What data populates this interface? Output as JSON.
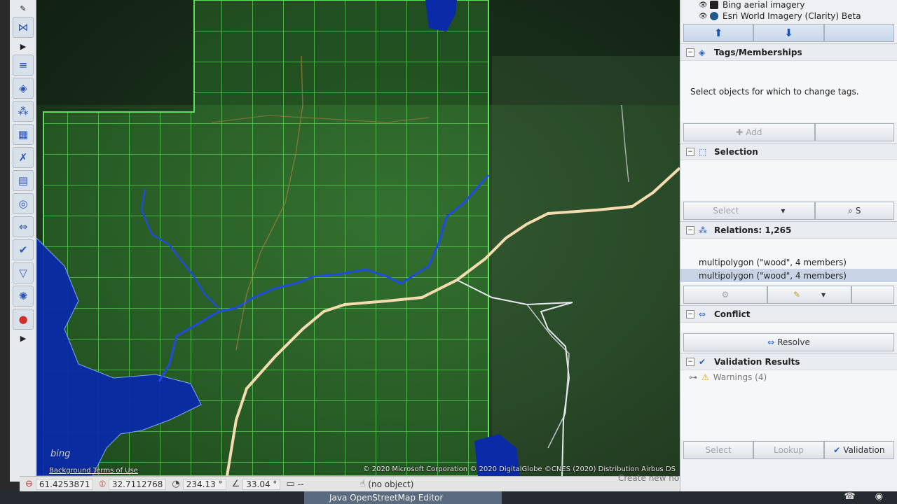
{
  "window_title": "Java OpenStreetMap Editor",
  "layers": [
    {
      "name": "Bing aerial imagery"
    },
    {
      "name": "Esri World Imagery (Clarity) Beta"
    }
  ],
  "tags_panel": {
    "title": "Tags/Memberships",
    "empty_message": "Select objects for which to change tags.",
    "add_label": "Add"
  },
  "selection_panel": {
    "title": "Selection",
    "select_label": "Select",
    "search_label": "S"
  },
  "relations_panel": {
    "title": "Relations: 1,265",
    "items": [
      {
        "label": "multipolygon (\"wood\", 4 members)"
      },
      {
        "label": "multipolygon (\"wood\", 4 members)"
      }
    ]
  },
  "conflict_panel": {
    "title": "Conflict",
    "resolve_label": "Resolve"
  },
  "validation_panel": {
    "title": "Validation Results",
    "warnings_label": "Warnings (4)",
    "select_label": "Select",
    "lookup_label": "Lookup",
    "validation_label": "Validation"
  },
  "status": {
    "lat": "61.4253871",
    "lon": "32.7112768",
    "heading": "234.13 °",
    "angle": "33.04 °",
    "distance": "--",
    "object": "(no object)",
    "help": "Create new node."
  },
  "map": {
    "attribution": "© 2020 Microsoft Corporation © 2020 DigitalGlobe ©CNES (2020) Distribution Airbus DS",
    "terms": "Background Terms of Use",
    "logo": "bing"
  },
  "colors": {
    "grid": "#5fe05a",
    "water": "#0a2aa8",
    "river": "#1f4be0",
    "road": "#f2dcb0",
    "path": "#e8e8f0"
  }
}
